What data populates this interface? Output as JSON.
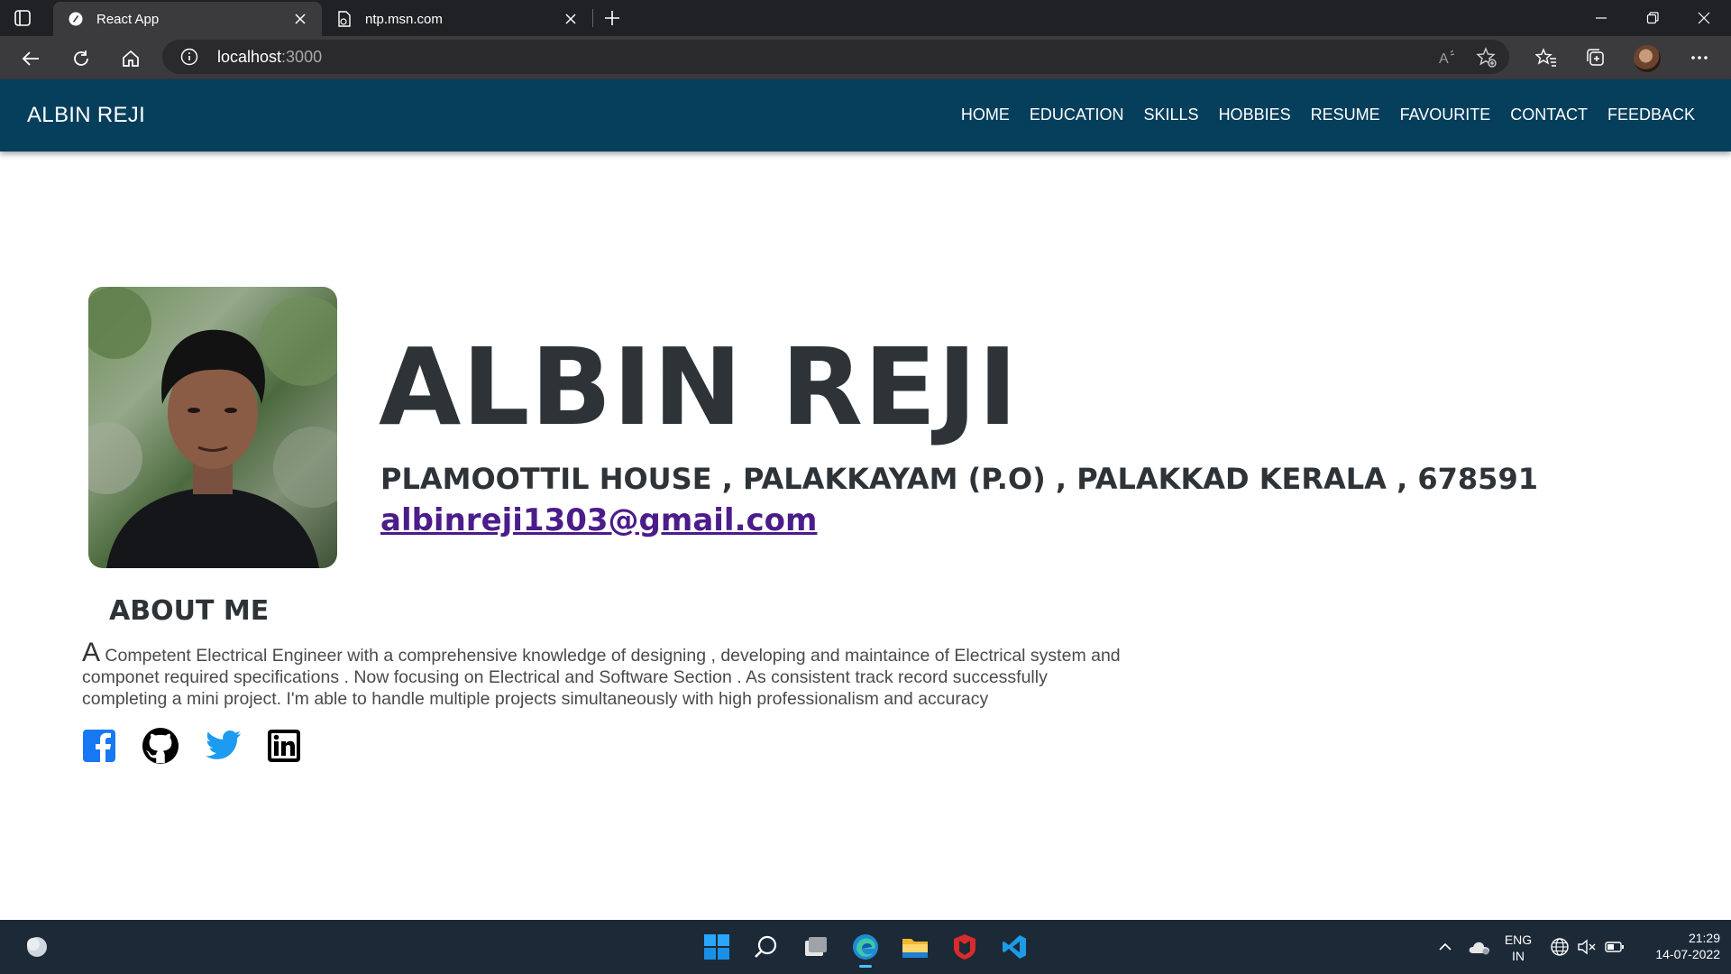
{
  "browser": {
    "tabs": [
      {
        "title": "React App",
        "icon": "react-app-favicon"
      },
      {
        "title": "ntp.msn.com",
        "icon": "page-icon"
      }
    ],
    "address": {
      "host": "localhost",
      "port": ":3000"
    }
  },
  "site": {
    "brand": "ALBIN REJI",
    "menu": [
      "HOME",
      "EDUCATION",
      "SKILLS",
      "HOBBIES",
      "RESUME",
      "FAVOURITE",
      "CONTACT",
      "FEEDBACK"
    ],
    "hero": {
      "name": "ALBIN REJI",
      "address": "PLAMOOTTIL HOUSE , PALAKKAYAM (P.O) , PALAKKAD KERALA , 678591",
      "email": "albinreji1303@gmail.com"
    },
    "about": {
      "title": "ABOUT ME",
      "dropcap": "A",
      "line1": " Competent Electrical Engineer with a comprehensive knowledge of designing , developing and maintaince of Electrical system and",
      "line2": "componet required specifications . Now focusing on Electrical and Software Section . As consistent track record successfully",
      "line3": "completing a mini project. I'm able to handle multiple projects simultaneously with high professionalism and accuracy"
    },
    "social_icons": [
      "facebook-icon",
      "github-icon",
      "twitter-icon",
      "linkedin-icon"
    ],
    "colors": {
      "navbar": "#053f5c",
      "text": "#2e3338",
      "email": "#4b1c8a",
      "facebook": "#1877f2",
      "twitter": "#1d9bf0"
    }
  },
  "taskbar": {
    "language": {
      "line1": "ENG",
      "line2": "IN"
    },
    "clock": {
      "time": "21:29",
      "date": "14-07-2022"
    }
  }
}
